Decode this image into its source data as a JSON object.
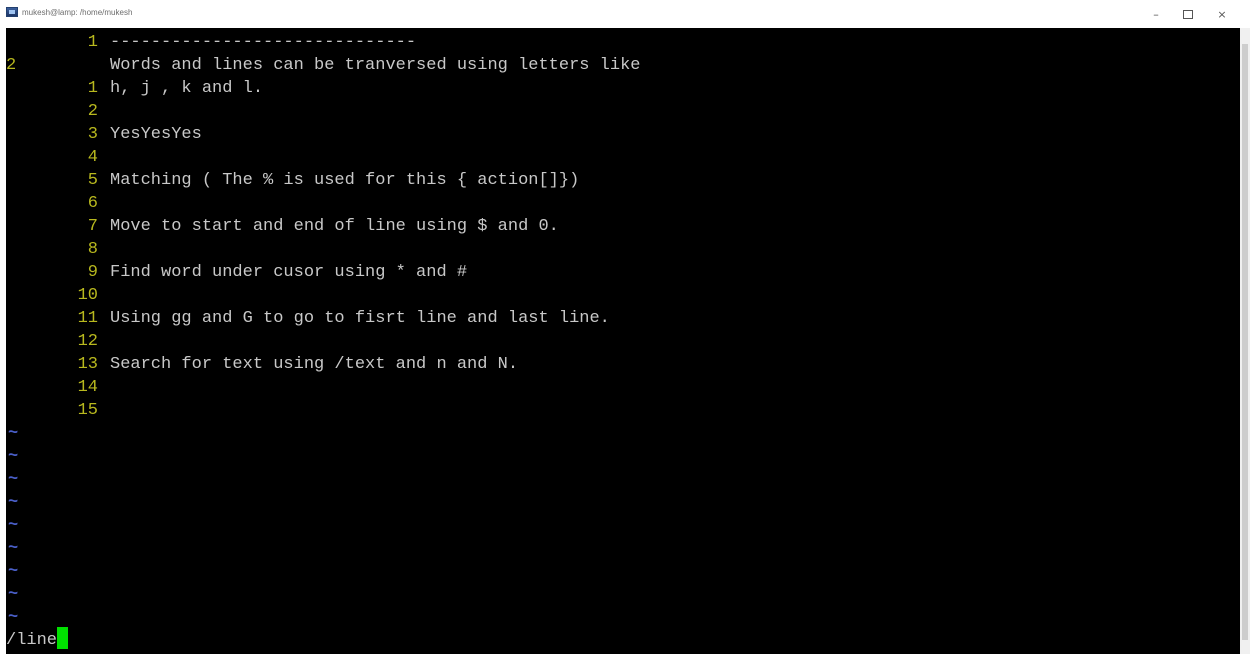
{
  "window": {
    "title": "mukesh@lamp: /home/mukesh",
    "minimize": "–",
    "close": "×"
  },
  "editor": {
    "lines": [
      {
        "num": "1",
        "text": "------------------------------"
      },
      {
        "num": "2",
        "text": "Words and lines can be tranversed using letters like"
      },
      {
        "num": "1",
        "text": "h, j , k and l."
      },
      {
        "num": "2",
        "text": ""
      },
      {
        "num": "3",
        "text": "YesYesYes"
      },
      {
        "num": "4",
        "text": ""
      },
      {
        "num": "5",
        "text": "Matching ( The % is used for this { action[]})"
      },
      {
        "num": "6",
        "text": ""
      },
      {
        "num": "7",
        "text": "Move to start and end of line using $ and 0."
      },
      {
        "num": "8",
        "text": ""
      },
      {
        "num": "9",
        "text": "Find word under cusor using * and #"
      },
      {
        "num": "10",
        "text": ""
      },
      {
        "num": "11",
        "text": "Using gg and G to go to fisrt line and last line."
      },
      {
        "num": "12",
        "text": ""
      },
      {
        "num": "13",
        "text": "Search for text using /text and n and N."
      },
      {
        "num": "14",
        "text": ""
      },
      {
        "num": "15",
        "text": ""
      }
    ],
    "tilde": "~",
    "command": "/line"
  },
  "colors": {
    "background": "#000000",
    "line_number": "#b8b81e",
    "text": "#c8c8c8",
    "tilde": "#4a5fc8",
    "cursor": "#00e000"
  }
}
